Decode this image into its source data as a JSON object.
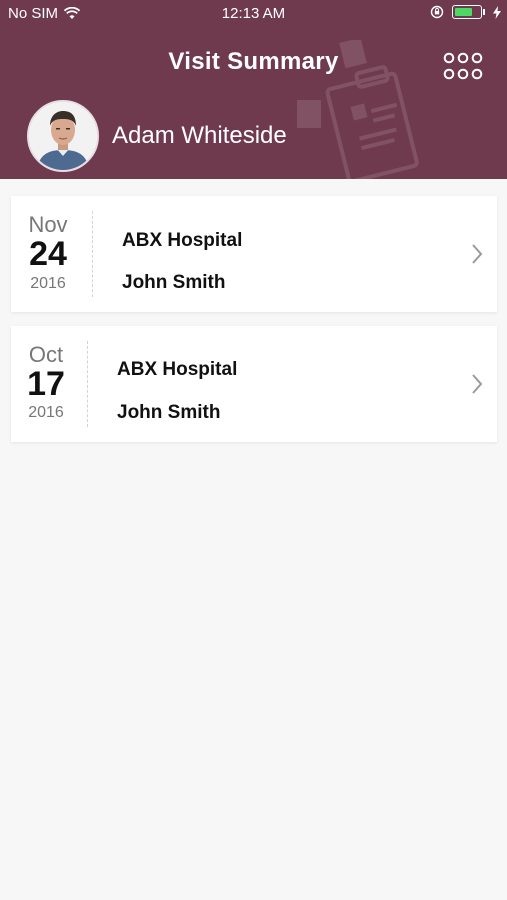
{
  "status_bar": {
    "carrier": "No SIM",
    "time": "12:13 AM",
    "battery_level": 0.75
  },
  "header": {
    "title": "Visit Summary",
    "user_name": "Adam Whiteside",
    "menu_icon": "grid-dots-icon"
  },
  "visits": [
    {
      "month": "Nov",
      "day": "24",
      "year": "2016",
      "hospital": "ABX Hospital",
      "doctor": "John Smith"
    },
    {
      "month": "Oct",
      "day": "17",
      "year": "2016",
      "hospital": "ABX Hospital",
      "doctor": "John Smith"
    }
  ],
  "colors": {
    "header_bg": "#6f3a4e",
    "background": "#f7f7f7",
    "card_bg": "#ffffff",
    "battery": "#4cd964"
  }
}
